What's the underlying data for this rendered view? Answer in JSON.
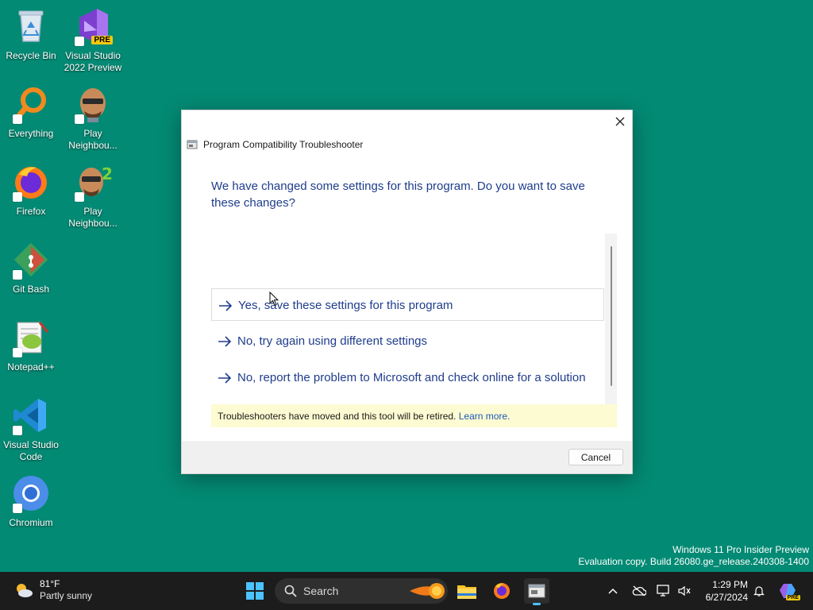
{
  "desktop": {
    "icons": [
      {
        "label": "Recycle Bin"
      },
      {
        "label": "Visual Studio 2022 Preview",
        "badge": "PRE"
      },
      {
        "label": "Everything"
      },
      {
        "label": "Play Neighbou..."
      },
      {
        "label": "Firefox"
      },
      {
        "label": "Play Neighbou..."
      },
      {
        "label": "Git Bash"
      },
      {
        "label": "Notepad++"
      },
      {
        "label": "Visual Studio Code"
      },
      {
        "label": "Chromium"
      }
    ]
  },
  "dialog": {
    "title": "Program Compatibility Troubleshooter",
    "heading": "We have changed some settings for this program. Do you want to save these changes?",
    "options": [
      {
        "label": "Yes, save these settings for this program"
      },
      {
        "label": "No, try again using different settings"
      },
      {
        "label": "No, report the problem to Microsoft and check online for a solution"
      }
    ],
    "notice": {
      "text": "Troubleshooters have moved and this tool will be retired.",
      "link": "Learn more."
    },
    "cancel_label": "Cancel"
  },
  "watermark": {
    "line1": "Windows 11 Pro Insider Preview",
    "line2": "Evaluation copy. Build 26080.ge_release.240308-1400"
  },
  "taskbar": {
    "weather": {
      "temp": "81°F",
      "condition": "Partly sunny"
    },
    "search_label": "Search",
    "clock": {
      "time": "1:29 PM",
      "date": "6/27/2024"
    },
    "copilot_badge": "PRE"
  },
  "colors": {
    "desktop_bg": "#038a74",
    "link_blue": "#1f3d8c",
    "notice_bg": "#fdfbd1",
    "taskbar_bg": "#1c1c1c"
  }
}
